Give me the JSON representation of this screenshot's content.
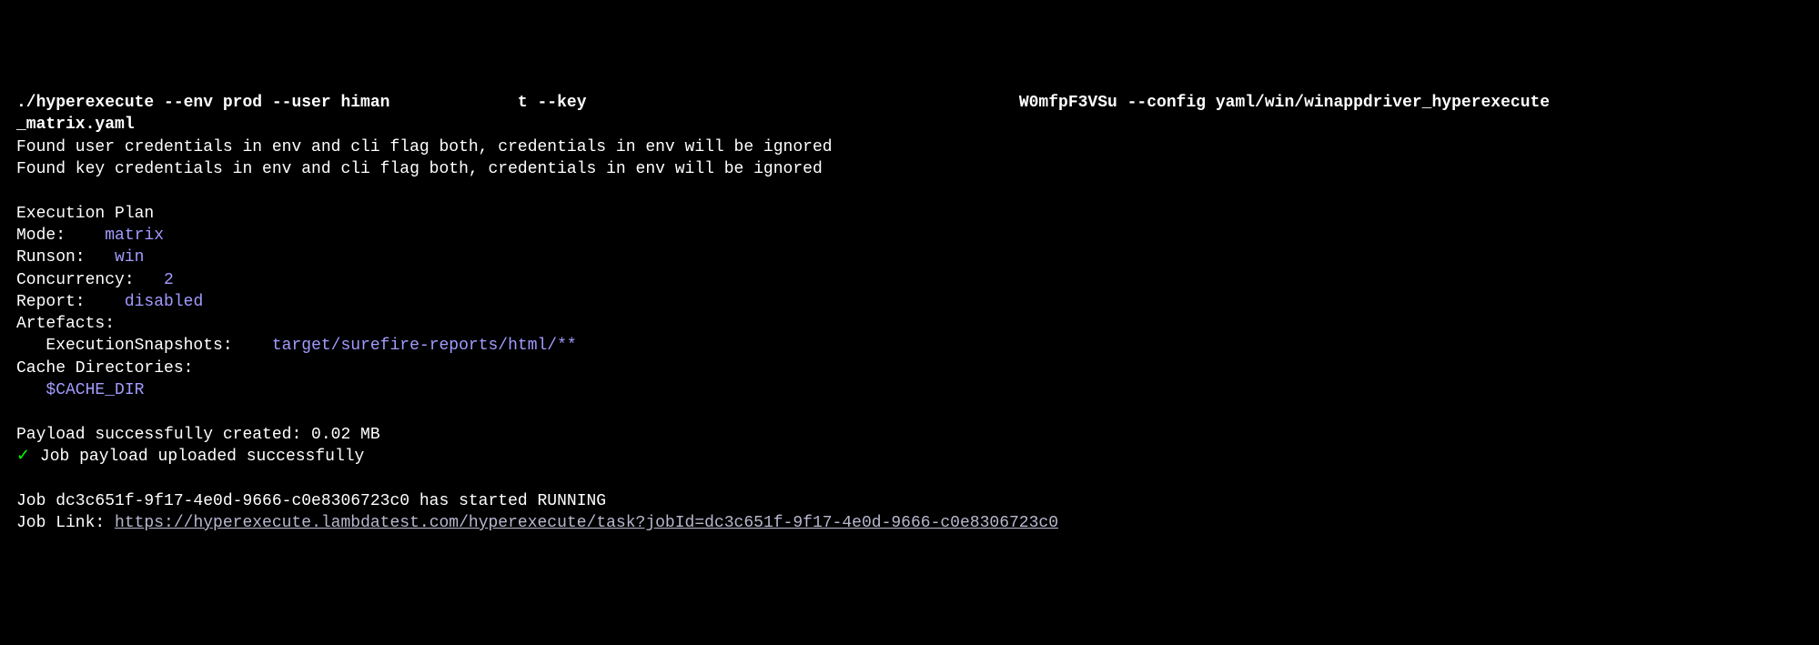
{
  "command": {
    "part1": "./hyperexecute --env prod --user himan",
    "part2": "t --key",
    "part3": "W0mfpF3VSu --config yaml/win/winappdriver_hyperexecute",
    "wrap": "_matrix.yaml"
  },
  "warnings": {
    "user_cred": "Found user credentials in env and cli flag both, credentials in env will be ignored",
    "key_cred": "Found key credentials in env and cli flag both, credentials in env will be ignored"
  },
  "plan": {
    "header": "Execution Plan",
    "mode_label": "Mode:    ",
    "mode_value": "matrix",
    "runson_label": "Runson:   ",
    "runson_value": "win",
    "concurrency_label": "Concurrency:   ",
    "concurrency_value": "2",
    "report_label": "Report:    ",
    "report_value": "disabled",
    "artefacts_label": "Artefacts:",
    "snapshot_label": "   ExecutionSnapshots:    ",
    "snapshot_value": "target/surefire-reports/html/**",
    "cache_label": "Cache Directories:",
    "cache_value": "   $CACHE_DIR"
  },
  "payload": {
    "created": "Payload successfully created: 0.02 MB",
    "check": "✓",
    "uploaded": " Job payload uploaded successfully"
  },
  "job": {
    "started": "Job dc3c651f-9f17-4e0d-9666-c0e8306723c0 has started RUNNING",
    "link_label": "Job Link: ",
    "link_url": "https://hyperexecute.lambdatest.com/hyperexecute/task?jobId=dc3c651f-9f17-4e0d-9666-c0e8306723c0"
  }
}
